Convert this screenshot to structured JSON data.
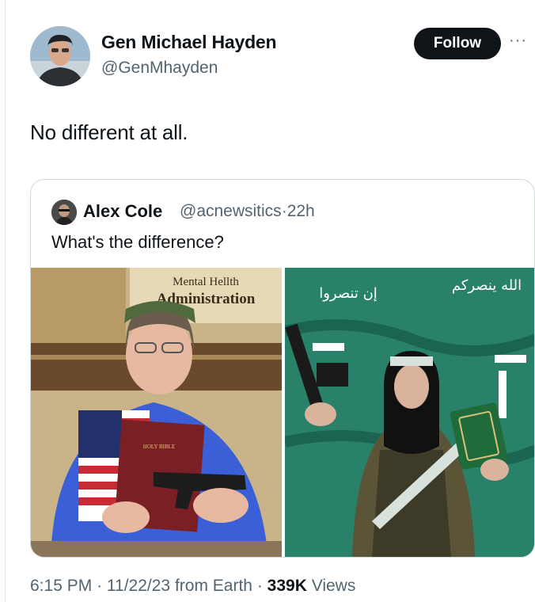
{
  "author": {
    "name": "Gen Michael Hayden",
    "handle": "@GenMhayden"
  },
  "follow_label": "Follow",
  "more_label": "···",
  "tweet_text": "No different at all.",
  "quoted": {
    "name": "Alex Cole",
    "handle": "@acnewsitics",
    "separator": "·",
    "age": "22h",
    "text": "What's the difference?",
    "left_image": {
      "sign_line1": "Mental Hellth",
      "sign_line2": "Administration",
      "bible_label": "HOLY BIBLE"
    },
    "right_image": {
      "banner_text_left": "إن تنصروا",
      "banner_text_right": "الله ينصركم"
    }
  },
  "footer": {
    "time": "6:15 PM",
    "date": "11/22/23",
    "source": "from Earth",
    "separator": "·",
    "views_count": "339K",
    "views_label": "Views"
  },
  "colors": {
    "text": "#0f1419",
    "secondary": "#536471",
    "border": "#cfd9de",
    "follow_bg": "#0f1419",
    "banner_green": "#1f8a74"
  },
  "icons": [
    "more-horizontal-icon"
  ]
}
